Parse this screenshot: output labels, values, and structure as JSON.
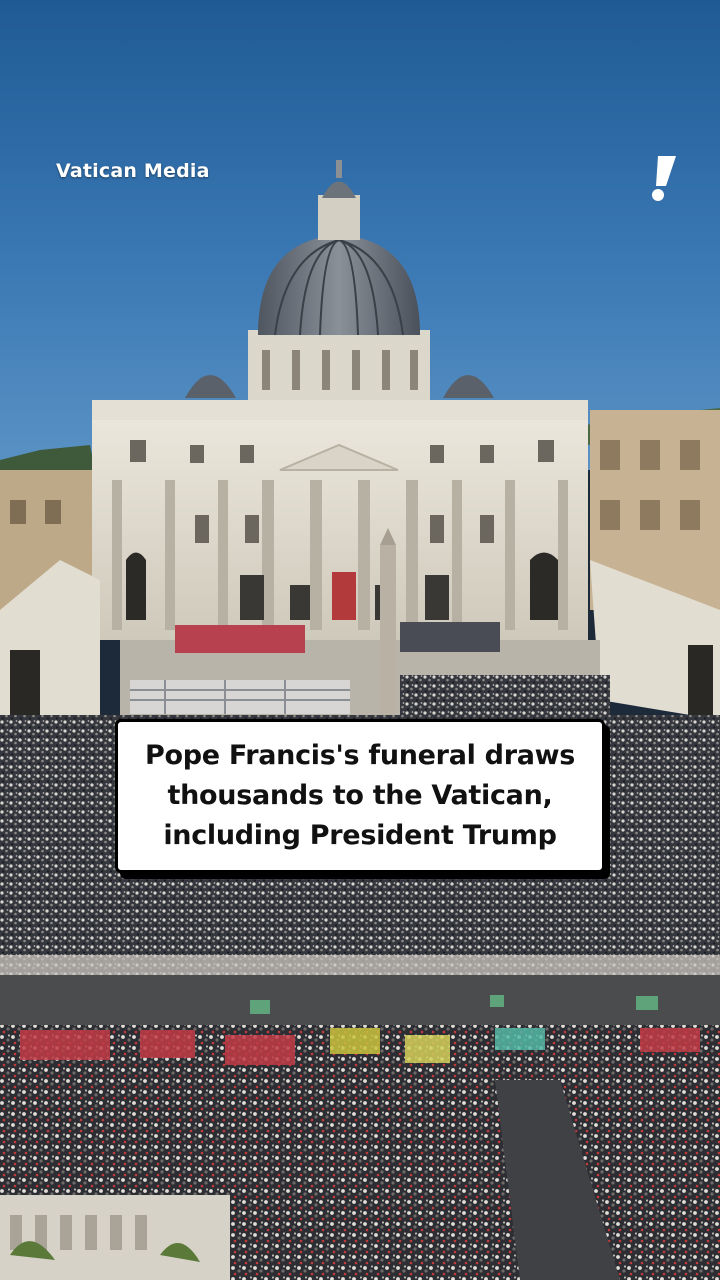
{
  "overlay": {
    "credit": "Vatican Media",
    "caption": "Pope Francis's funeral draws thousands to the Vatican, including President Trump"
  },
  "icons": {
    "brand": "exclamation-mark-logo"
  },
  "colors": {
    "sky": "#2f6aa8",
    "caption_bg": "#ffffff",
    "caption_border": "#000000",
    "text_light": "#ffffff"
  }
}
